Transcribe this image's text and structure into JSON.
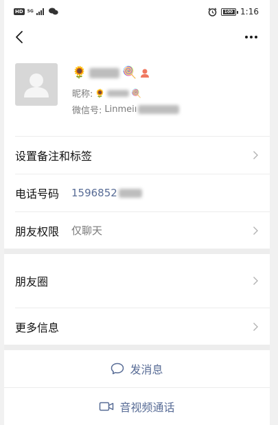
{
  "status_bar": {
    "hd_badge": "HD",
    "network": "5G",
    "time": "1:16",
    "battery": "100"
  },
  "profile": {
    "name_emoji_left": "🌻",
    "name_emoji_right": "🍭",
    "nickname_label": "昵称:",
    "nickname_emoji_left": "🌻",
    "nickname_emoji_right": "🍭",
    "wechat_id_label": "微信号:",
    "wechat_id_prefix": "Linmeiı"
  },
  "rows": {
    "remark_tags": {
      "label": "设置备注和标签"
    },
    "phone": {
      "label": "电话号码",
      "value": "1596852"
    },
    "permission": {
      "label": "朋友权限",
      "value": "仅聊天"
    },
    "moments": {
      "label": "朋友圈"
    },
    "more_info": {
      "label": "更多信息"
    }
  },
  "actions": {
    "send_message": "发消息",
    "av_call": "音视频通话"
  },
  "colors": {
    "link_blue": "#576b95",
    "gap_gray": "#ededed",
    "avatar_bg": "#d7d7d7"
  }
}
